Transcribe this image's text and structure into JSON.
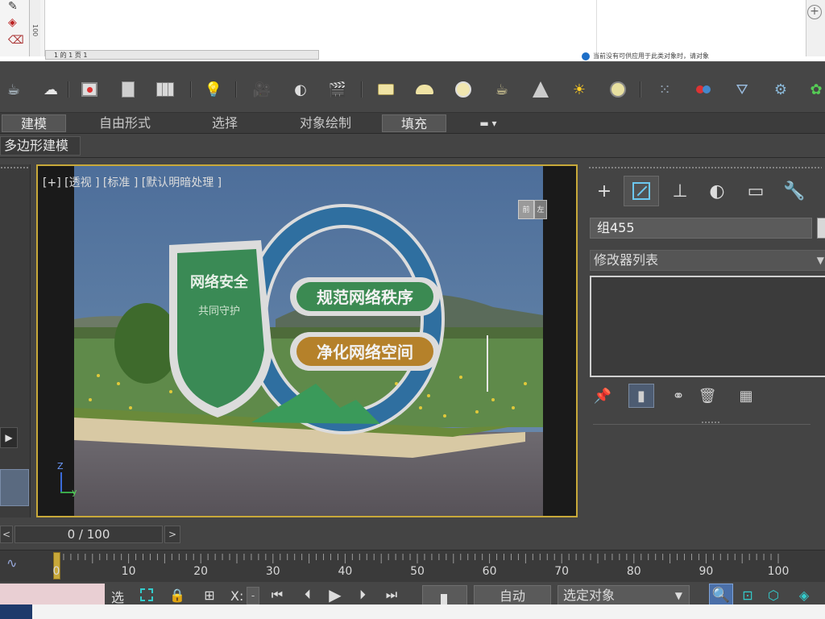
{
  "top_strip": {
    "ruler_label": "100",
    "page_bar": "1 的 1   页 1",
    "notice": "当前没有可供应用于此类对象时，请对象"
  },
  "ribbon": {
    "tabs": [
      {
        "label": "建模",
        "active": true
      },
      {
        "label": "自由形式",
        "active": false
      },
      {
        "label": "选择",
        "active": false
      },
      {
        "label": "对象绘制",
        "active": false
      },
      {
        "label": "填充",
        "active": true
      }
    ],
    "sub_label": "多边形建模"
  },
  "viewport": {
    "label": "[+] [透视 ] [标准 ] [默认明暗处理 ]",
    "viewcube_face_left": "前",
    "viewcube_face_right": "左",
    "axis_z": "Z",
    "axis_y": "y",
    "sign_lines": [
      "规范网络秩序",
      "净化网络空间"
    ],
    "shield_text": "网络安全",
    "shield_subtext": "共同守护"
  },
  "command_panel": {
    "object_name": "组455",
    "modifier_list": "修改器列表"
  },
  "time_slider": {
    "value": "0 / 100",
    "prev": "<",
    "next": ">"
  },
  "track_bar": {
    "ticks": [
      0,
      10,
      20,
      30,
      40,
      50,
      60,
      70,
      80,
      90,
      100
    ]
  },
  "status_bar": {
    "select_label": "选",
    "x_label": "X:",
    "x_value": "-",
    "auto_key": "自动",
    "selection_set": "选定对象"
  },
  "colors": {
    "viewport_border": "#c8a93a",
    "shield_green": "#3a8a55",
    "sign_green": "#3b8a52",
    "sign_orange": "#b5812a",
    "ring_blue": "#2f6fa0"
  }
}
